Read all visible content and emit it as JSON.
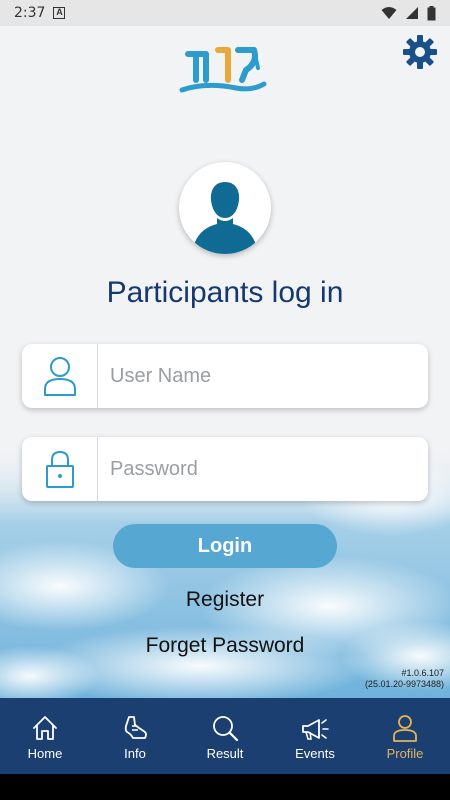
{
  "status": {
    "time": "2:37",
    "notif_badge": "A"
  },
  "header": {
    "logo_icon": "app-logo",
    "settings_icon": "gear-icon"
  },
  "avatar_icon": "user-silhouette-icon",
  "title": "Participants log in",
  "form": {
    "username": {
      "placeholder": "User Name",
      "value": "",
      "icon": "user-icon"
    },
    "password": {
      "placeholder": "Password",
      "value": "",
      "icon": "lock-icon"
    },
    "login_label": "Login",
    "register_label": "Register",
    "forget_label": "Forget Password"
  },
  "version": {
    "line1": "#1.0.6.107",
    "line2": "(25.01.20-9973488)"
  },
  "nav": {
    "items": [
      {
        "label": "Home",
        "icon": "home-icon"
      },
      {
        "label": "Info",
        "icon": "running-shoe-icon"
      },
      {
        "label": "Result",
        "icon": "search-icon"
      },
      {
        "label": "Events",
        "icon": "megaphone-icon"
      },
      {
        "label": "Profile",
        "icon": "profile-icon",
        "active": true
      }
    ]
  },
  "colors": {
    "brand_navy": "#15386f",
    "nav_background": "#1b3f70",
    "login_button": "#56a7d2",
    "active_tab": "#e3b45a",
    "icon_blue": "#2d9bcc"
  }
}
